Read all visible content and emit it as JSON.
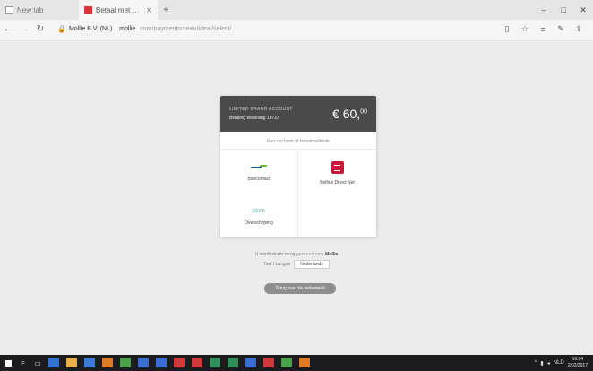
{
  "browser": {
    "tabs": [
      {
        "title": "New tab",
        "icon": "page-icon",
        "active": false
      },
      {
        "title": "Betaal met Bancontact",
        "icon": "red-favicon-icon",
        "active": true
      }
    ],
    "new_tab": "+",
    "window": {
      "minimize": "–",
      "maximize": "□",
      "close": "✕"
    },
    "nav": {
      "back": "←",
      "forward": "→",
      "refresh": "↻"
    },
    "url": {
      "host": "Mollie B.V. (NL)",
      "separator": "|",
      "domain": "mollie",
      "path": ".com/paymentscreen/ideal/select/..."
    },
    "toolbar_icons": {
      "reading": "▯",
      "favorite": "☆",
      "hub": "≡",
      "notes": "✎",
      "share": "⇪"
    }
  },
  "card": {
    "merchant_line1": "LIMITED BRAND ACCOUNT",
    "merchant_line2": "Betaling bestelling 18723",
    "amount_symbol": "€",
    "amount_main": "60,",
    "amount_cents": "00",
    "choose_label": "Kies uw bank of betaalmethode",
    "methods": [
      {
        "label": "Bancontact",
        "icon": "bank-logo-icon"
      },
      {
        "label": "Belfius Direct Net",
        "icon": "belfius-logo-icon"
      },
      {
        "label": "Overschrijving",
        "icon": "bank-transfer-logo-icon",
        "logo_text": "SEPA"
      }
    ]
  },
  "redirect": {
    "prefix": "U wordt straks terug",
    "link": "gestuurd naar",
    "merchant": "Mollie"
  },
  "language": {
    "label": "Taal / Langue",
    "value": "Nederlands"
  },
  "cancel_button": "Terug naar de webwinkel",
  "taskbar": {
    "apps": [
      {
        "icon": "search-icon",
        "glyph": "⌕"
      },
      {
        "icon": "task-view-icon",
        "glyph": "▭"
      },
      {
        "icon": "edge-icon",
        "color": "#2f74d0"
      },
      {
        "icon": "file-explorer-icon",
        "color": "#e8b04a"
      },
      {
        "icon": "store-icon",
        "color": "#3a7bd5"
      },
      {
        "icon": "mail-icon",
        "color": "#e07a24"
      },
      {
        "icon": "chrome-icon",
        "color": "#4aa34a"
      },
      {
        "icon": "app-icon",
        "color": "#3b6fd6"
      },
      {
        "icon": "app-icon",
        "color": "#3b6fd6"
      },
      {
        "icon": "app-icon",
        "color": "#d23a3a"
      },
      {
        "icon": "app-icon",
        "color": "#d23a3a"
      },
      {
        "icon": "app-icon",
        "color": "#2f8f5a"
      },
      {
        "icon": "app-icon",
        "color": "#2f8f5a"
      },
      {
        "icon": "app-icon",
        "color": "#3b6fd6"
      },
      {
        "icon": "app-icon",
        "color": "#d23a3a"
      },
      {
        "icon": "app-icon",
        "color": "#4aa34a"
      },
      {
        "icon": "app-icon",
        "color": "#e07a24"
      }
    ],
    "tray": {
      "lang": "NLD",
      "time": "16:24",
      "date": "2/02/2017"
    }
  }
}
